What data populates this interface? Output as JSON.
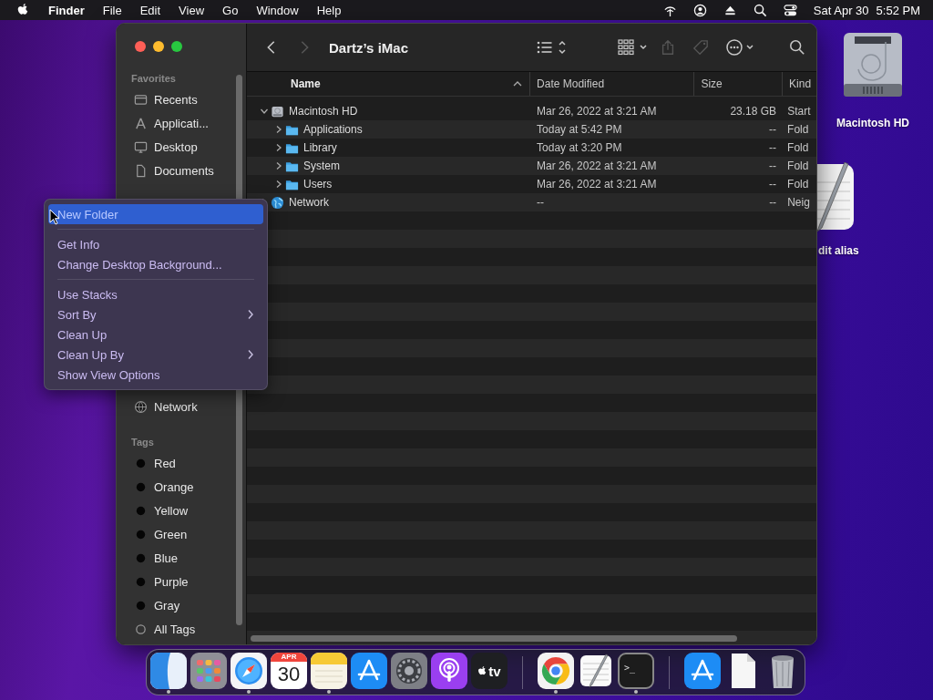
{
  "menu_bar": {
    "app_name": "Finder",
    "menus": [
      "File",
      "Edit",
      "View",
      "Go",
      "Window",
      "Help"
    ],
    "status_icons": [
      {
        "kind": "antenna"
      },
      {
        "kind": "user"
      },
      {
        "kind": "eject"
      },
      {
        "kind": "search"
      },
      {
        "kind": "toggles"
      }
    ],
    "date": "Sat Apr 30",
    "time": "5:52 PM"
  },
  "desktop": {
    "icons": [
      {
        "kind": "disk",
        "label": "Macintosh HD"
      },
      {
        "kind": "textedit",
        "label": "dit alias"
      }
    ]
  },
  "window": {
    "title": "Dartz’s iMac",
    "toolbar": [
      {
        "kind": "back",
        "disabled": false
      },
      {
        "kind": "forward",
        "disabled": true
      },
      {
        "kind": "title"
      },
      {
        "kind": "list-view",
        "disabled": false
      },
      {
        "kind": "group",
        "disabled": false
      },
      {
        "kind": "share",
        "disabled": true
      },
      {
        "kind": "tag",
        "disabled": true
      },
      {
        "kind": "action",
        "disabled": false
      },
      {
        "kind": "search",
        "disabled": false
      }
    ],
    "sidebar": [
      {
        "heading": "Favorites",
        "items": [
          {
            "label": "Recents",
            "kind": "recents",
            "selected": false
          },
          {
            "label": "Applicati...",
            "kind": "applications",
            "selected": false
          },
          {
            "label": "Desktop",
            "kind": "desktop",
            "selected": false
          },
          {
            "label": "Documents",
            "kind": "documents",
            "selected": false
          }
        ]
      },
      {
        "items": [
          {
            "label": "Network",
            "kind": "network",
            "selected": false
          }
        ]
      },
      {
        "heading": "Tags",
        "items": [
          {
            "label": "Red",
            "kind": "tag",
            "selected": false
          },
          {
            "label": "Orange",
            "kind": "tag",
            "selected": false
          },
          {
            "label": "Yellow",
            "kind": "tag",
            "selected": false
          },
          {
            "label": "Green",
            "kind": "tag",
            "selected": false
          },
          {
            "label": "Blue",
            "kind": "tag",
            "selected": false
          },
          {
            "label": "Purple",
            "kind": "tag",
            "selected": false
          },
          {
            "label": "Gray",
            "kind": "tag",
            "selected": false
          },
          {
            "label": "All Tags",
            "kind": "all-tags",
            "selected": false
          }
        ]
      }
    ],
    "table": {
      "columns": [
        {
          "label": "Name",
          "sorted": true
        },
        {
          "label": "Date Modified",
          "sorted": false
        },
        {
          "label": "Size",
          "sorted": false
        },
        {
          "label": "Kind",
          "sorted": false
        }
      ],
      "rows": [
        {
          "name": "Macintosh HD",
          "kind": "disk",
          "expanded": true,
          "date_modified": "Mar 26, 2022 at 3:21 AM",
          "size": "23.18 GB",
          "file_kind": "Start",
          "children": [
            {
              "name": "Applications",
              "kind": "folder",
              "expanded": false,
              "date_modified": "Today at 5:42 PM",
              "size": "--",
              "file_kind": "Fold"
            },
            {
              "name": "Library",
              "kind": "folder",
              "expanded": false,
              "date_modified": "Today at 3:20 PM",
              "size": "--",
              "file_kind": "Fold"
            },
            {
              "name": "System",
              "kind": "folder",
              "expanded": false,
              "date_modified": "Mar 26, 2022 at 3:21 AM",
              "size": "--",
              "file_kind": "Fold"
            },
            {
              "name": "Users",
              "kind": "folder",
              "expanded": false,
              "date_modified": "Mar 26, 2022 at 3:21 AM",
              "size": "--",
              "file_kind": "Fold"
            }
          ]
        },
        {
          "name": "Network",
          "kind": "network",
          "expanded": false,
          "date_modified": "--",
          "size": "--",
          "file_kind": "Neig"
        }
      ]
    }
  },
  "context_menu": {
    "items": [
      {
        "kind": "item",
        "label": "New Folder",
        "selected": true,
        "submenu": false
      },
      {
        "kind": "separator"
      },
      {
        "kind": "item",
        "label": "Get Info",
        "selected": false,
        "submenu": false
      },
      {
        "kind": "item",
        "label": "Change Desktop Background...",
        "selected": false,
        "submenu": false
      },
      {
        "kind": "separator"
      },
      {
        "kind": "item",
        "label": "Use Stacks",
        "selected": false,
        "submenu": false
      },
      {
        "kind": "item",
        "label": "Sort By",
        "selected": false,
        "submenu": true
      },
      {
        "kind": "item",
        "label": "Clean Up",
        "selected": false,
        "submenu": false
      },
      {
        "kind": "item",
        "label": "Clean Up By",
        "selected": false,
        "submenu": true
      },
      {
        "kind": "item",
        "label": "Show View Options",
        "selected": false,
        "submenu": false
      }
    ]
  },
  "dock": {
    "items": [
      {
        "kind": "finder",
        "running": true
      },
      {
        "kind": "launchpad",
        "running": false
      },
      {
        "kind": "safari",
        "running": true
      },
      {
        "kind": "calendar",
        "month": "APR",
        "day": "30",
        "running": false
      },
      {
        "kind": "notes",
        "running": true
      },
      {
        "kind": "appstore",
        "running": false
      },
      {
        "kind": "settings",
        "running": false
      },
      {
        "kind": "podcasts",
        "running": false
      },
      {
        "kind": "tv",
        "label": "tv",
        "running": false
      },
      {
        "kind": "separator"
      },
      {
        "kind": "chrome",
        "running": true
      },
      {
        "kind": "textedit",
        "running": false
      },
      {
        "kind": "terminal",
        "label": ">_",
        "running": true
      },
      {
        "kind": "separator"
      },
      {
        "kind": "appstore",
        "running": false
      },
      {
        "kind": "document",
        "running": false
      },
      {
        "kind": "trash",
        "running": false
      }
    ]
  }
}
